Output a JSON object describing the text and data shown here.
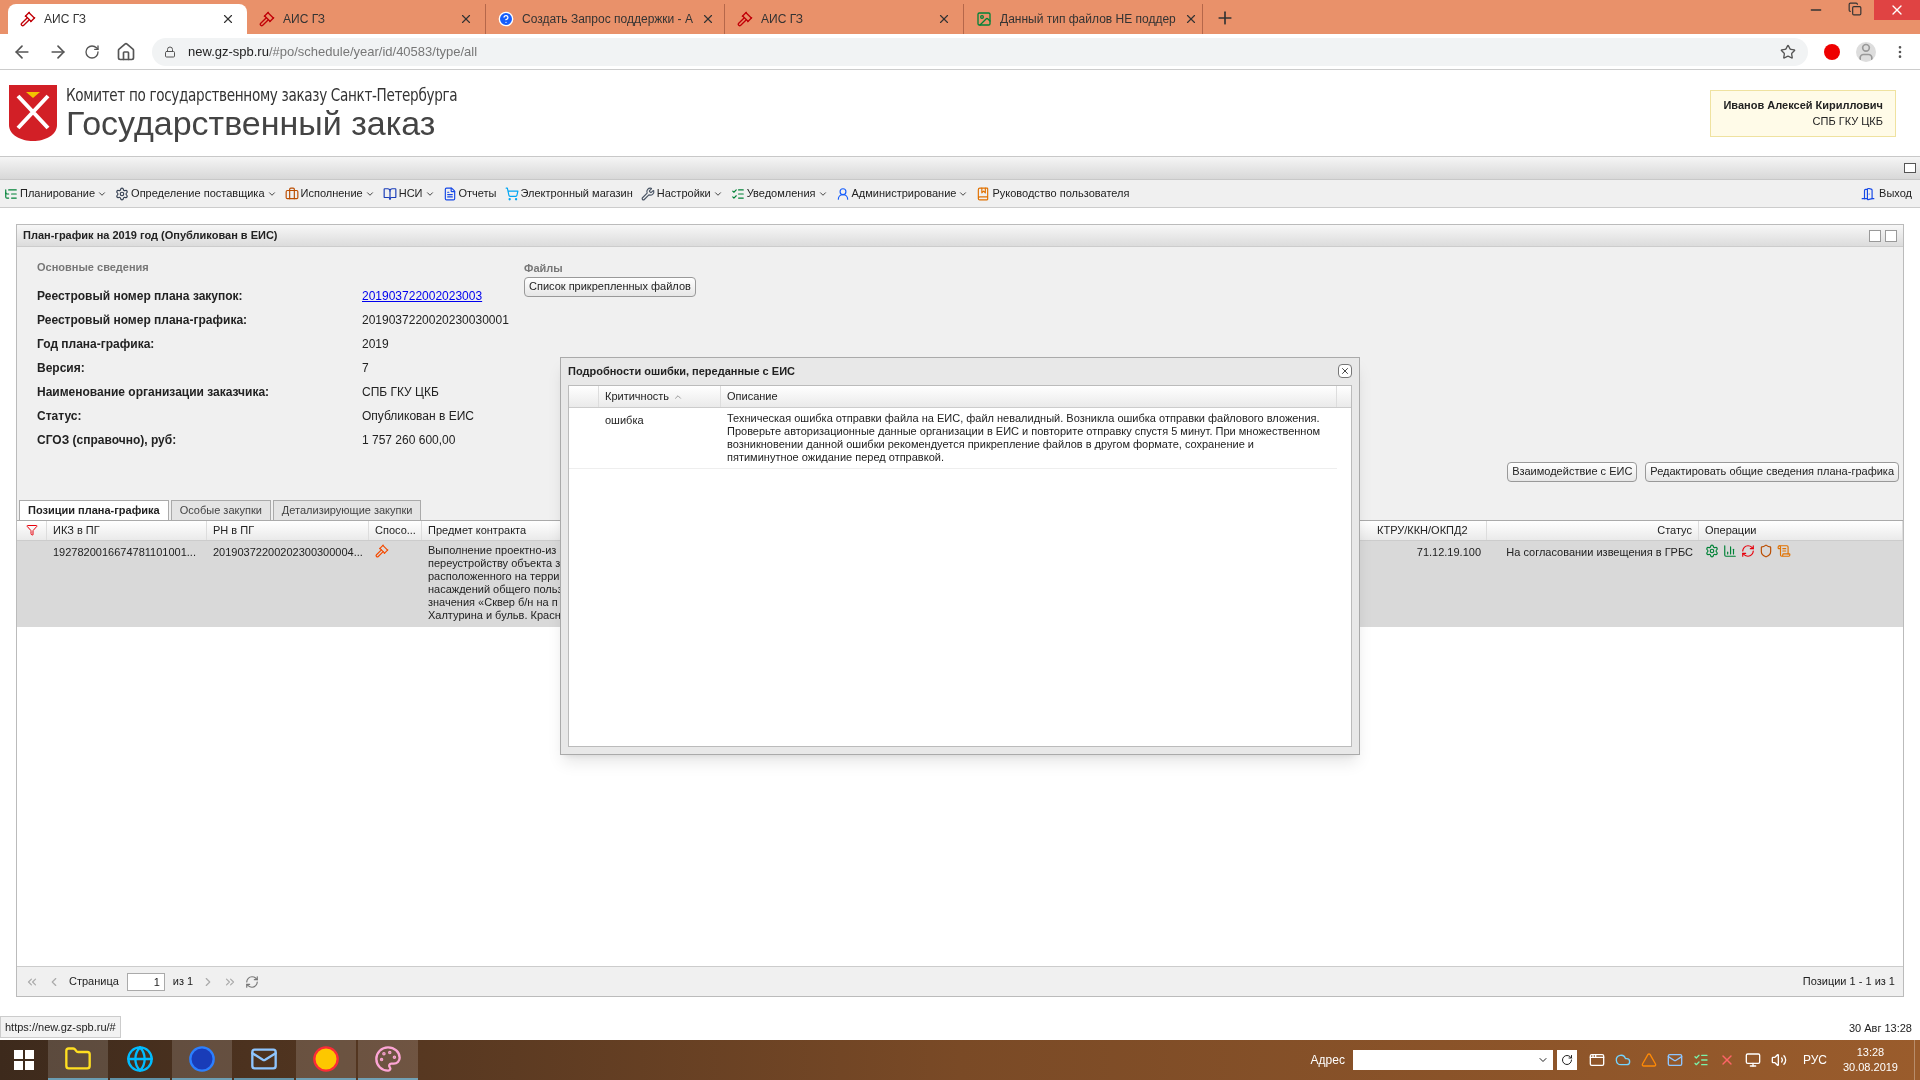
{
  "browser": {
    "tabs": [
      {
        "title": "АИС ГЗ",
        "kind": "gavel",
        "selected": true
      },
      {
        "title": "АИС ГЗ",
        "kind": "gavel",
        "selected": false
      },
      {
        "title": "Создать Запрос поддержки - А",
        "kind": "help",
        "selected": false
      },
      {
        "title": "АИС ГЗ",
        "kind": "gavel",
        "selected": false
      },
      {
        "title": "Данный тип файлов НЕ поддер",
        "kind": "image",
        "selected": false
      }
    ],
    "url_host": "new.gz-spb.ru",
    "url_path": "/#po/schedule/year/id/40583/type/all"
  },
  "header": {
    "org": "Комитет по государственному заказу Санкт-Петербурга",
    "title": "Государственный заказ",
    "user_name": "Иванов Алексей Кириллович",
    "user_org": "СПБ ГКУ ЦКБ"
  },
  "menu": [
    {
      "label": "Планирование",
      "dropdown": true
    },
    {
      "label": "Определение поставщика",
      "dropdown": true
    },
    {
      "label": "Исполнение",
      "dropdown": true
    },
    {
      "label": "НСИ",
      "dropdown": true
    },
    {
      "label": "Отчеты",
      "dropdown": false
    },
    {
      "label": "Электронный магазин",
      "dropdown": false
    },
    {
      "label": "Настройки",
      "dropdown": true
    },
    {
      "label": "Уведомления",
      "dropdown": true
    },
    {
      "label": "Администрирование",
      "dropdown": true
    },
    {
      "label": "Руководство пользователя",
      "dropdown": false
    }
  ],
  "logout": "Выход",
  "panel": {
    "title": "План-график на 2019 год (Опубликован в ЕИС)",
    "section": "Основные сведения",
    "files_label": "Файлы",
    "files_button": "Список прикрепленных файлов",
    "fields": [
      {
        "label": "Реестровый номер плана закупок:",
        "value": "201903722002023003",
        "kind": "link"
      },
      {
        "label": "Реестровый номер плана-графика:",
        "value": "2019037220020230030001",
        "kind": "text"
      },
      {
        "label": "Год плана-графика:",
        "value": "2019",
        "kind": "text"
      },
      {
        "label": "Версия:",
        "value": "7",
        "kind": "text"
      },
      {
        "label": "Наименование организации заказчика:",
        "value": "СПБ ГКУ ЦКБ",
        "kind": "text"
      },
      {
        "label": "Статус:",
        "value": "Опубликован в ЕИС",
        "kind": "text"
      },
      {
        "label": "СГОЗ (справочно), руб:",
        "value": "1 757 260 600,00",
        "kind": "text"
      }
    ],
    "actions": [
      "Взаимодействие с ЕИС",
      "Редактировать общие сведения плана-графика"
    ],
    "tabs": [
      {
        "label": "Позиции плана-графика",
        "selected": true
      },
      {
        "label": "Особые закупки",
        "selected": false
      },
      {
        "label": "Детализирующие закупки",
        "selected": false
      }
    ],
    "columns": [
      "ИКЗ в ПГ",
      "РН в ПГ",
      "Спосо...",
      "Предмет контракта",
      "КТРУ/ККН/ОКПД2",
      "Статус",
      "Операции"
    ],
    "rows": [
      {
        "selected": true,
        "ikz": "1927820016674781101001...",
        "rn": "20190372200202300300004...",
        "subject": [
          "Выполнение проектно-из",
          "переустройству объекта з",
          "расположенного на терри",
          "насаждений общего польз",
          "значения «Сквер б/н на п",
          "Халтурина и бульв. Красн"
        ],
        "ktru": "71.12.19.100",
        "status": "На согласовании извещения в ГРБС"
      }
    ]
  },
  "paging": {
    "page_label": "Страница",
    "page": "1",
    "of": "из 1",
    "summary": "Позиции 1 - 1 из 1"
  },
  "dialog": {
    "title": "Подробности ошибки, переданные с ЕИС",
    "columns": [
      "Критичность",
      "Описание"
    ],
    "rows": [
      {
        "severity": "ошибка",
        "description": [
          "Техническая ошибка отправки файла на ЕИС, файл невалидный. Возникла ошибка отправки файлового вложения.",
          "Проверьте авторизационные данные организации в ЕИС и повторите отправку спустя 5 минут. При множественном",
          "возникновении данной ошибки рекомендуется прикрепление файлов в другом формате, сохранение и",
          "пятиминутное ожидание перед отправкой."
        ]
      }
    ]
  },
  "status_url": "https://new.gz-spb.ru/#",
  "status_time": "30 Авг 13:28",
  "taskbar": {
    "address_label": "Адрес",
    "lang": "РУС",
    "time": "13:28",
    "date": "30.08.2019"
  }
}
